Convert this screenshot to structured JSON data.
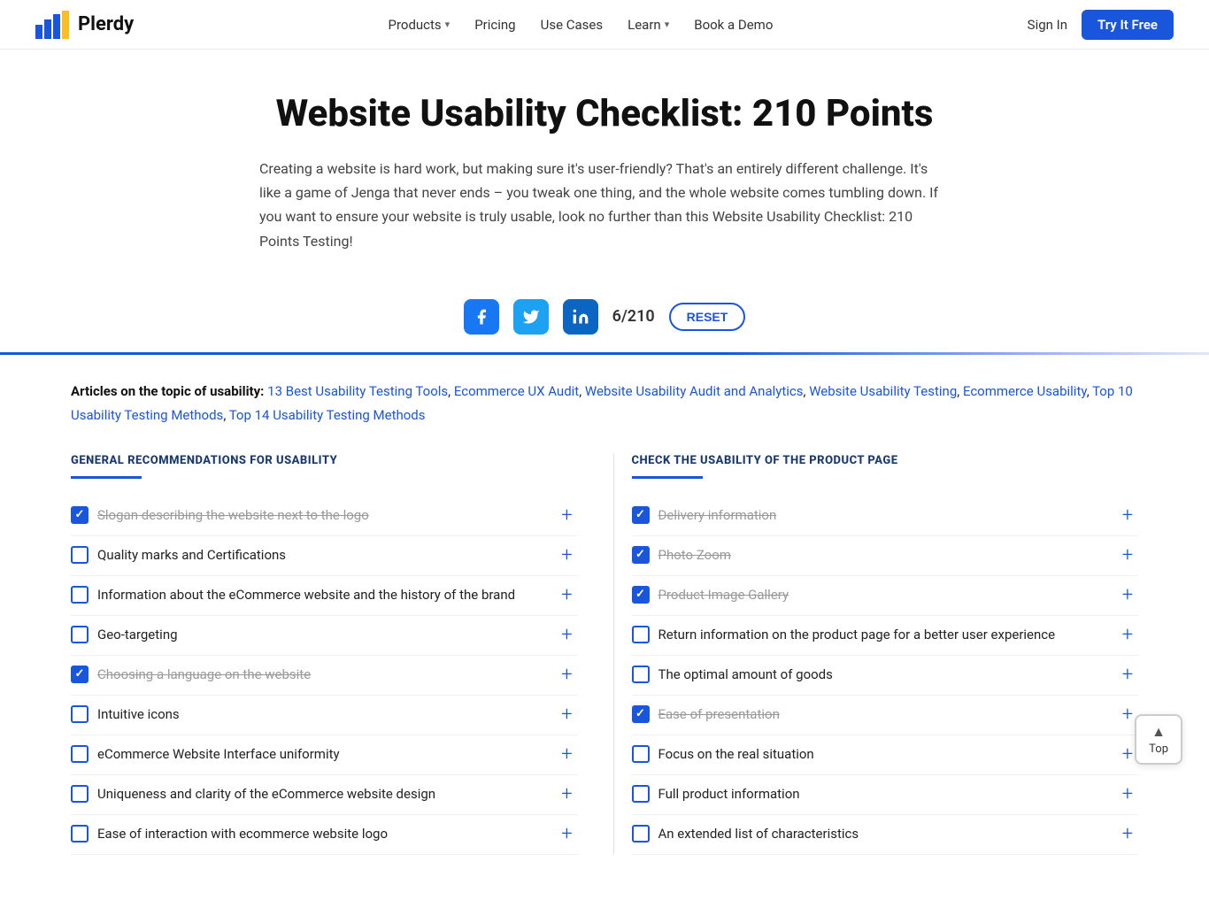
{
  "nav": {
    "logo_text": "Plerdy",
    "links": [
      {
        "label": "Products",
        "has_dropdown": true
      },
      {
        "label": "Pricing",
        "has_dropdown": false
      },
      {
        "label": "Use Cases",
        "has_dropdown": false
      },
      {
        "label": "Learn",
        "has_dropdown": true
      },
      {
        "label": "Book a Demo",
        "has_dropdown": false
      }
    ],
    "sign_in": "Sign In",
    "try_free": "Try It Free"
  },
  "hero": {
    "title": "Website Usability Checklist: 210 Points",
    "description": "Creating a website is hard work, but making sure it's user-friendly? That's an entirely different challenge. It's like a game of Jenga that never ends – you tweak one thing, and the whole website comes tumbling down. If you want to ensure your website is truly usable, look no further than this Website Usability Checklist: 210 Points Testing!"
  },
  "share": {
    "counter": "6/210",
    "reset_label": "RESET"
  },
  "articles": {
    "label": "Articles on the topic of usability:",
    "links": [
      "13 Best Usability Testing Tools",
      "Ecommerce UX Audit",
      "Website Usability Audit and Analytics",
      "Website Usability Testing",
      "Ecommerce Usability",
      "Top 10 Usability Testing Methods",
      "Top 14 Usability Testing Methods"
    ]
  },
  "left_col": {
    "title": "GENERAL RECOMMENDATIONS FOR USABILITY",
    "items": [
      {
        "text": "Slogan describing the website next to the logo",
        "checked": true,
        "strikethrough": true
      },
      {
        "text": "Quality marks and Certifications",
        "checked": false,
        "strikethrough": false
      },
      {
        "text": "Information about the eCommerce website and the history of the brand",
        "checked": false,
        "strikethrough": false
      },
      {
        "text": "Geo-targeting",
        "checked": false,
        "strikethrough": false
      },
      {
        "text": "Choosing a language on the website",
        "checked": true,
        "strikethrough": true
      },
      {
        "text": "Intuitive icons",
        "checked": false,
        "strikethrough": false
      },
      {
        "text": "eCommerce Website Interface uniformity",
        "checked": false,
        "strikethrough": false
      },
      {
        "text": "Uniqueness and clarity of the eCommerce website design",
        "checked": false,
        "strikethrough": false
      },
      {
        "text": "Ease of interaction with ecommerce website logo",
        "checked": false,
        "strikethrough": false
      }
    ]
  },
  "right_col": {
    "title": "CHECK THE USABILITY OF THE PRODUCT PAGE",
    "items": [
      {
        "text": "Delivery information",
        "checked": true,
        "strikethrough": true
      },
      {
        "text": "Photo Zoom",
        "checked": true,
        "strikethrough": true
      },
      {
        "text": "Product Image Gallery",
        "checked": true,
        "strikethrough": true
      },
      {
        "text": "Return information on the product page for a better user experience",
        "checked": false,
        "strikethrough": false
      },
      {
        "text": "The optimal amount of goods",
        "checked": false,
        "strikethrough": false
      },
      {
        "text": "Ease of presentation",
        "checked": true,
        "strikethrough": true
      },
      {
        "text": "Focus on the real situation",
        "checked": false,
        "strikethrough": false
      },
      {
        "text": "Full product information",
        "checked": false,
        "strikethrough": false
      },
      {
        "text": "An extended list of characteristics",
        "checked": false,
        "strikethrough": false
      }
    ]
  },
  "top_btn": "Top"
}
